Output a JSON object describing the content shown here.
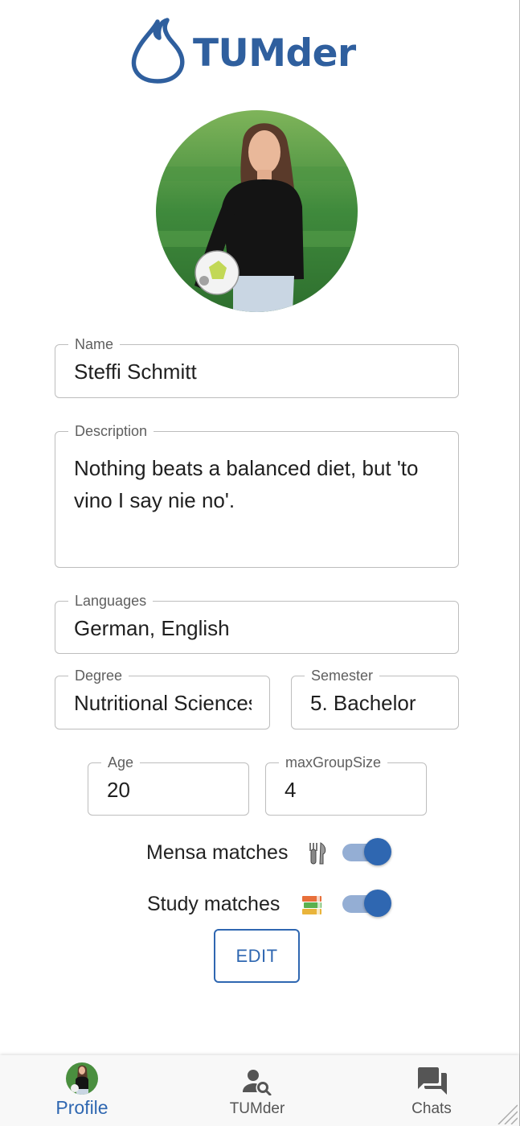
{
  "app": {
    "name": "TUMder",
    "accent": "#2f67b1",
    "logo_color": "#2f5f9e"
  },
  "profile": {
    "avatar": "profile-photo",
    "name": {
      "label": "Name",
      "value": "Steffi Schmitt"
    },
    "description": {
      "label": "Description",
      "value": "Nothing beats a balanced diet, but 'to vino I say nie no'."
    },
    "languages": {
      "label": "Languages",
      "value": "German, English"
    },
    "degree": {
      "label": "Degree",
      "value": "Nutritional Sciences"
    },
    "semester": {
      "label": "Semester",
      "value": "5. Bachelor"
    },
    "age": {
      "label": "Age",
      "value": "20"
    },
    "max_group_size": {
      "label": "maxGroupSize",
      "value": "4"
    }
  },
  "toggles": {
    "mensa": {
      "label": "Mensa matches",
      "icon": "fork-knife-emoji",
      "on": true
    },
    "study": {
      "label": "Study matches",
      "icon": "books-emoji",
      "on": true
    }
  },
  "edit_button": {
    "label": "EDIT"
  },
  "bottom_nav": {
    "items": [
      {
        "label": "Profile",
        "icon": "avatar",
        "active": true
      },
      {
        "label": "TUMder",
        "icon": "person-search-icon",
        "active": false
      },
      {
        "label": "Chats",
        "icon": "chat-bubbles-icon",
        "active": false
      }
    ]
  }
}
